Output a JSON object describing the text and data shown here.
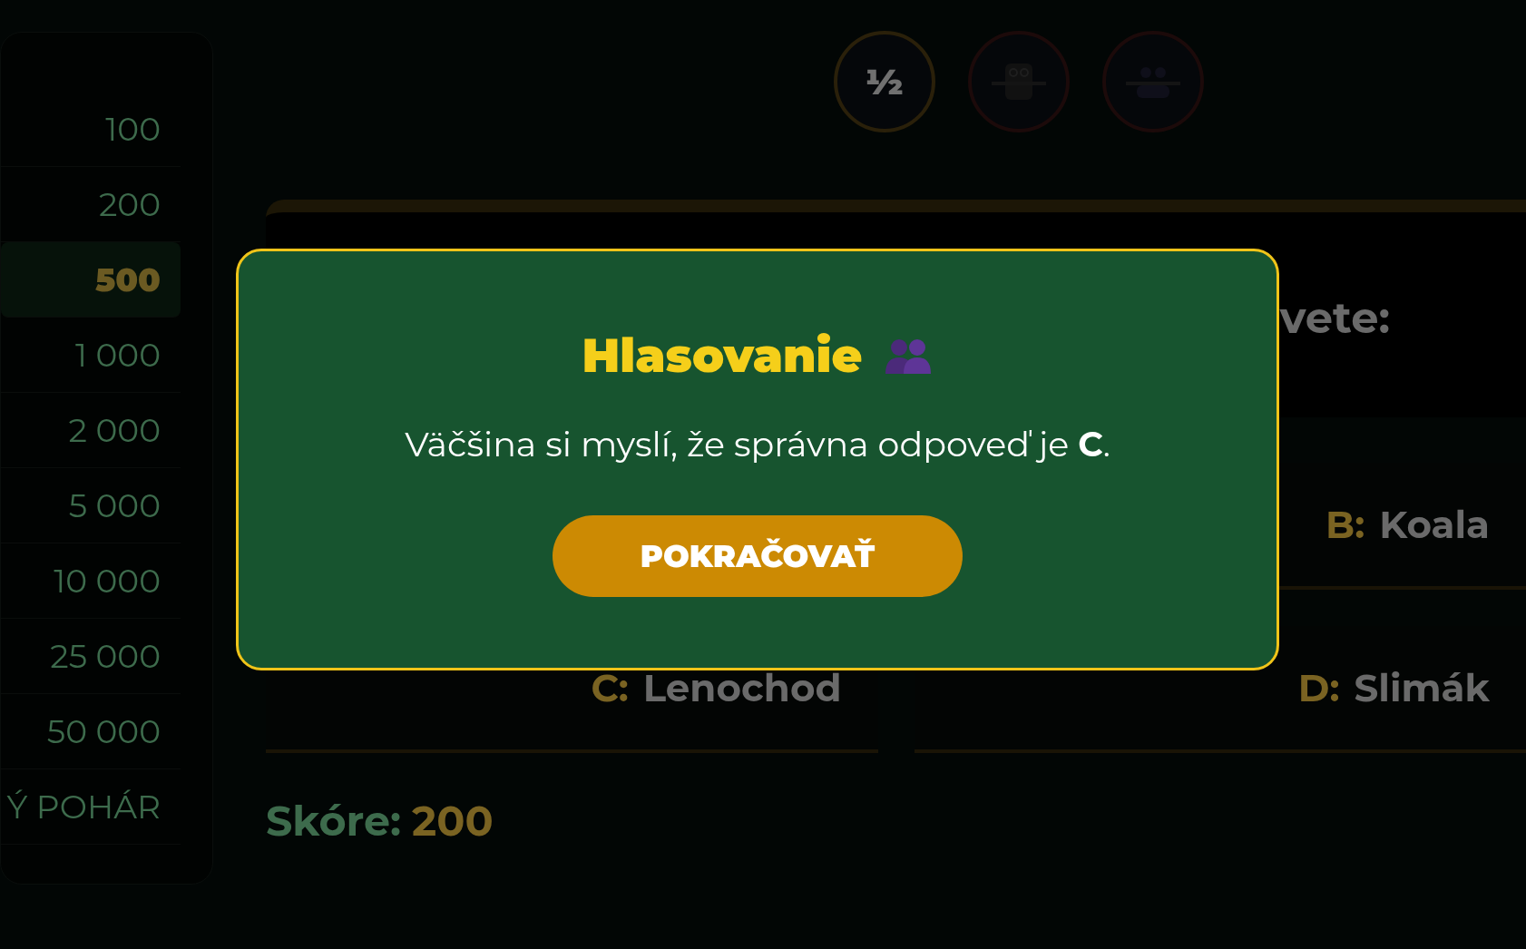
{
  "ladder": [
    {
      "label": "100",
      "selected": false
    },
    {
      "label": "200",
      "selected": false
    },
    {
      "label": "500",
      "selected": true
    },
    {
      "label": "1 000",
      "selected": false
    },
    {
      "label": "2 000",
      "selected": false
    },
    {
      "label": "5 000",
      "selected": false
    },
    {
      "label": "10 000",
      "selected": false
    },
    {
      "label": "25 000",
      "selected": false
    },
    {
      "label": "50 000",
      "selected": false
    },
    {
      "label": "Ý POHÁR",
      "selected": false
    }
  ],
  "lifelines": [
    {
      "kind": "fifty",
      "label": "½",
      "used": false
    },
    {
      "kind": "owl",
      "used": true
    },
    {
      "kind": "audience",
      "used": true
    }
  ],
  "question": {
    "text": "vete:"
  },
  "answers": [
    {
      "letter": "B:",
      "text": "Koala"
    },
    {
      "letter": "C:",
      "text": "Lenochod"
    },
    {
      "letter": "D:",
      "text": "Slimák"
    }
  ],
  "score": {
    "label": "Skóre:",
    "value": "200"
  },
  "modal": {
    "title": "Hlasovanie",
    "message": "Väčšina si myslí, že správna odpoveď je **C**.",
    "button": "POKRAČOVAŤ"
  }
}
